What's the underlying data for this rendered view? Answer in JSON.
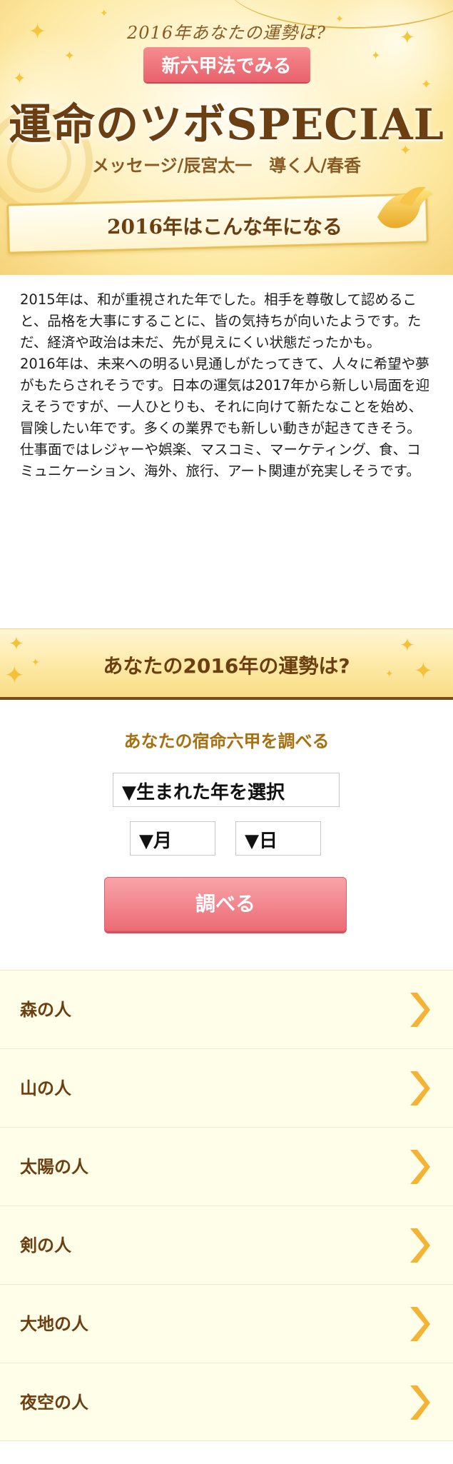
{
  "header": {
    "subtitle": "2016年あなたの運勢は?",
    "badge": "新六甲法でみる",
    "title": "運命のツボSPECIAL",
    "credit": "メッセージ/辰宮太一　導く人/春香",
    "ribbon": "2016年はこんな年になる"
  },
  "intro": {
    "paragraphs": [
      "2015年は、和が重視された年でした。相手を尊敬して認めること、品格を大事にすることに、皆の気持ちが向いたようです。ただ、経済や政治は未だ、先が見えにくい状態だったかも。",
      "2016年は、未来への明るい見通しがたってきて、人々に希望や夢がもたらされそうです。日本の運気は2017年から新しい局面を迎えそうですが、一人ひとりも、それに向けて新たなことを始め、冒険したい年です。多くの業界でも新しい動きが起きてきそう。",
      "仕事面ではレジャーや娯楽、マスコミ、マーケティング、食、コミュニケーション、海外、旅行、アート関連が充実しそうです。"
    ]
  },
  "section": {
    "title": "あなたの2016年の運勢は?"
  },
  "form": {
    "title": "あなたの宿命六甲を調べる",
    "year_select": "▼生まれた年を選択",
    "month_select": "▼月",
    "day_select": "▼日",
    "submit": "調べる"
  },
  "types": [
    {
      "label": "森の人"
    },
    {
      "label": "山の人"
    },
    {
      "label": "太陽の人"
    },
    {
      "label": "剣の人"
    },
    {
      "label": "大地の人"
    },
    {
      "label": "夜空の人"
    }
  ],
  "colors": {
    "accent_brown": "#6b3f12",
    "gold": "#a67011",
    "button_pink": "#ec6b76",
    "list_bg": "#fffee8",
    "chevron": "#f5b335"
  }
}
